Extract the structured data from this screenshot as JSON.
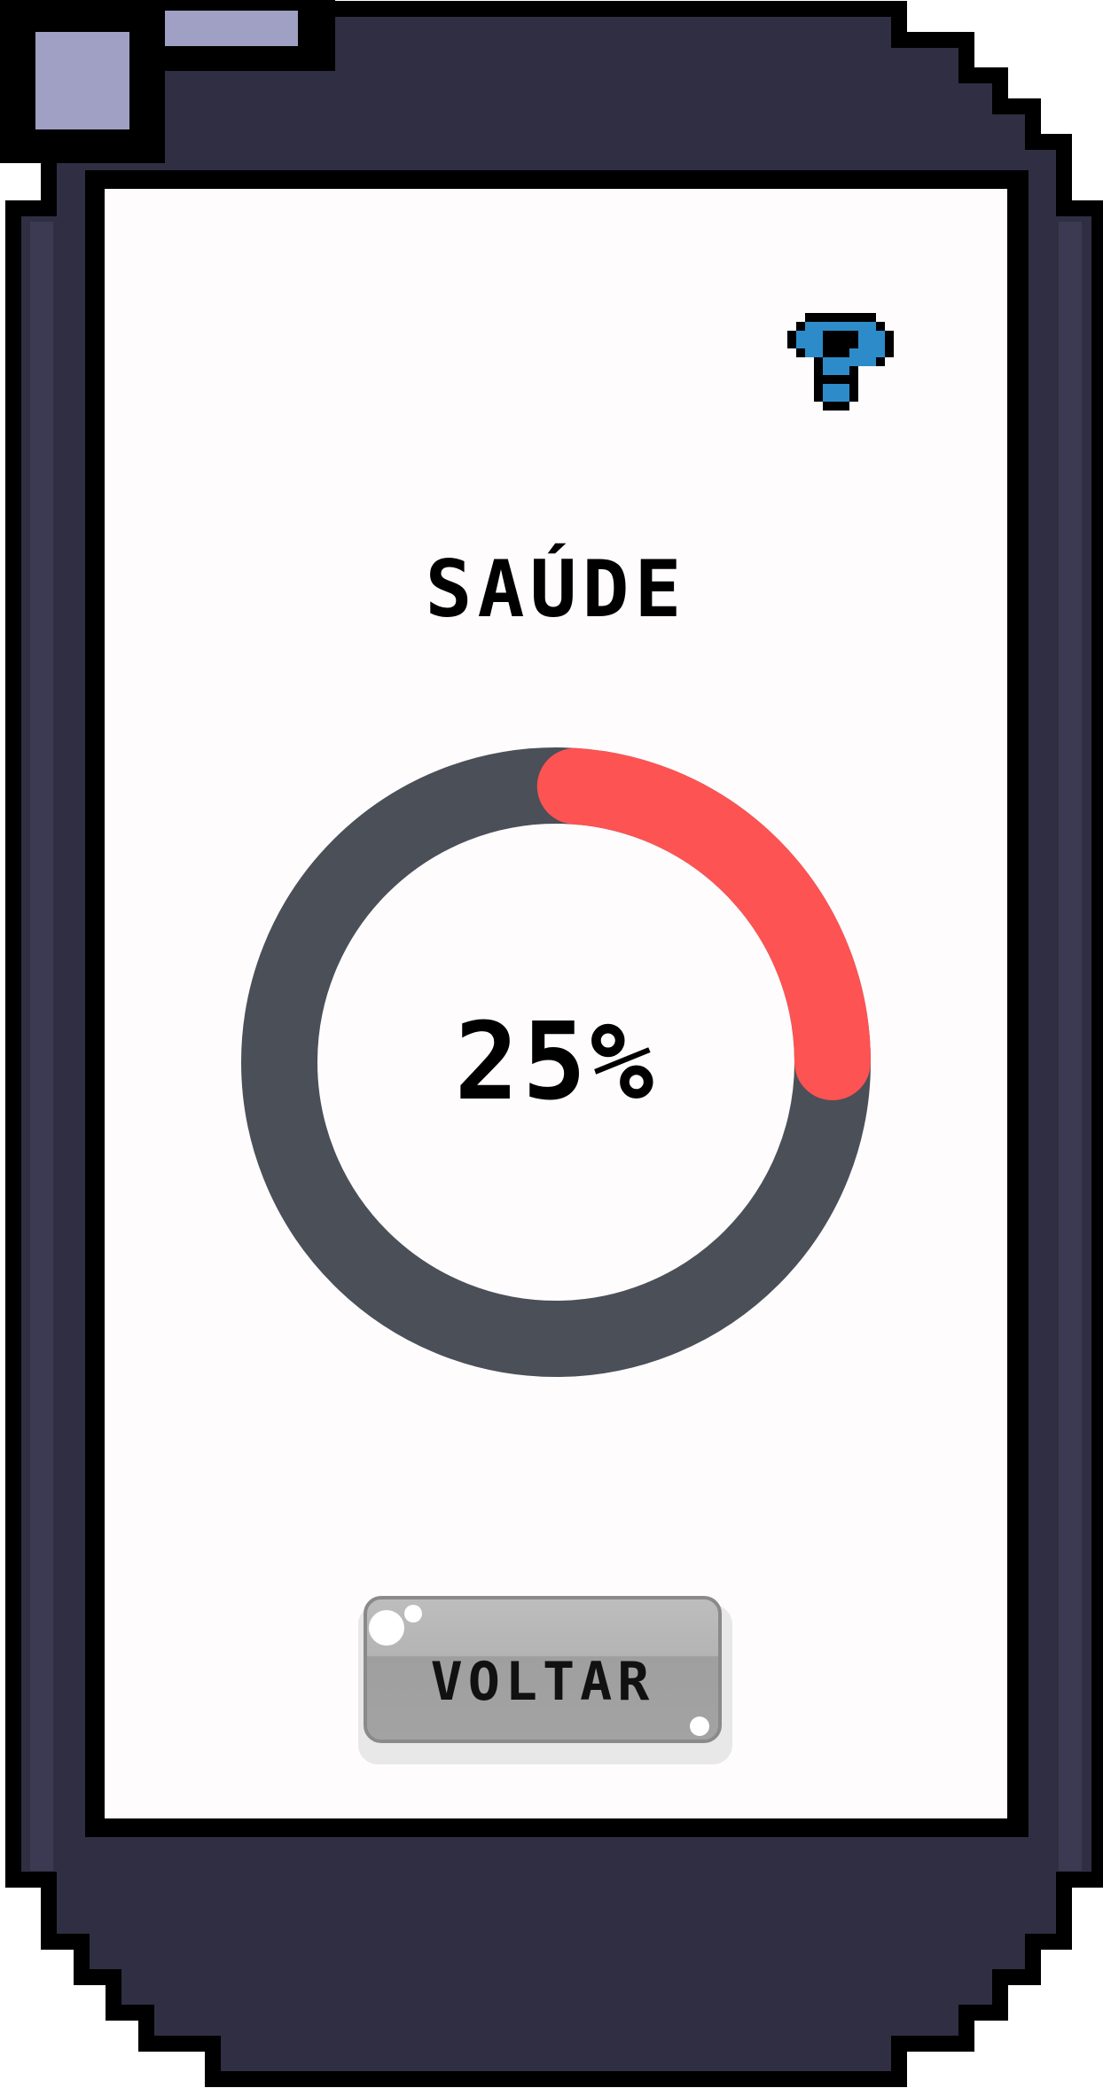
{
  "screen": {
    "title": "SAÚDE",
    "help_icon": "question-mark-icon",
    "gauge": {
      "value_text": "25%",
      "value": 25,
      "track_color": "#4a4f58",
      "fill_color": "#fd5353"
    },
    "back_button_label": "VOLTAR"
  },
  "device": {
    "body_color": "#2f2e42",
    "outline_color": "#000000",
    "accent_color": "#9fa0c4"
  }
}
